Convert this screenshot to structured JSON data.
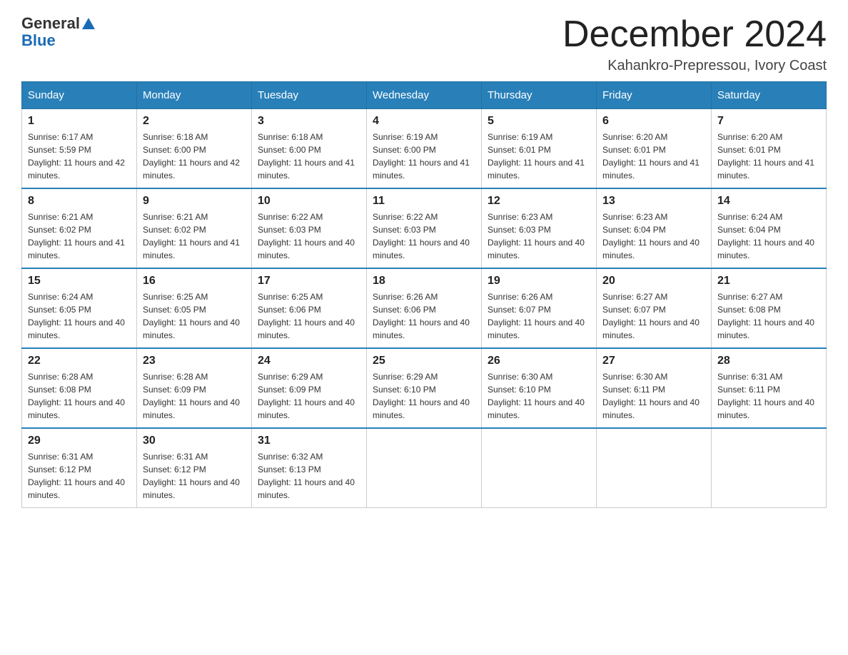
{
  "header": {
    "logo_general": "General",
    "logo_blue": "Blue",
    "month_title": "December 2024",
    "location": "Kahankro-Prepressou, Ivory Coast"
  },
  "calendar": {
    "days_of_week": [
      "Sunday",
      "Monday",
      "Tuesday",
      "Wednesday",
      "Thursday",
      "Friday",
      "Saturday"
    ],
    "weeks": [
      [
        {
          "day": "1",
          "sunrise": "6:17 AM",
          "sunset": "5:59 PM",
          "daylight": "11 hours and 42 minutes."
        },
        {
          "day": "2",
          "sunrise": "6:18 AM",
          "sunset": "6:00 PM",
          "daylight": "11 hours and 42 minutes."
        },
        {
          "day": "3",
          "sunrise": "6:18 AM",
          "sunset": "6:00 PM",
          "daylight": "11 hours and 41 minutes."
        },
        {
          "day": "4",
          "sunrise": "6:19 AM",
          "sunset": "6:00 PM",
          "daylight": "11 hours and 41 minutes."
        },
        {
          "day": "5",
          "sunrise": "6:19 AM",
          "sunset": "6:01 PM",
          "daylight": "11 hours and 41 minutes."
        },
        {
          "day": "6",
          "sunrise": "6:20 AM",
          "sunset": "6:01 PM",
          "daylight": "11 hours and 41 minutes."
        },
        {
          "day": "7",
          "sunrise": "6:20 AM",
          "sunset": "6:01 PM",
          "daylight": "11 hours and 41 minutes."
        }
      ],
      [
        {
          "day": "8",
          "sunrise": "6:21 AM",
          "sunset": "6:02 PM",
          "daylight": "11 hours and 41 minutes."
        },
        {
          "day": "9",
          "sunrise": "6:21 AM",
          "sunset": "6:02 PM",
          "daylight": "11 hours and 41 minutes."
        },
        {
          "day": "10",
          "sunrise": "6:22 AM",
          "sunset": "6:03 PM",
          "daylight": "11 hours and 40 minutes."
        },
        {
          "day": "11",
          "sunrise": "6:22 AM",
          "sunset": "6:03 PM",
          "daylight": "11 hours and 40 minutes."
        },
        {
          "day": "12",
          "sunrise": "6:23 AM",
          "sunset": "6:03 PM",
          "daylight": "11 hours and 40 minutes."
        },
        {
          "day": "13",
          "sunrise": "6:23 AM",
          "sunset": "6:04 PM",
          "daylight": "11 hours and 40 minutes."
        },
        {
          "day": "14",
          "sunrise": "6:24 AM",
          "sunset": "6:04 PM",
          "daylight": "11 hours and 40 minutes."
        }
      ],
      [
        {
          "day": "15",
          "sunrise": "6:24 AM",
          "sunset": "6:05 PM",
          "daylight": "11 hours and 40 minutes."
        },
        {
          "day": "16",
          "sunrise": "6:25 AM",
          "sunset": "6:05 PM",
          "daylight": "11 hours and 40 minutes."
        },
        {
          "day": "17",
          "sunrise": "6:25 AM",
          "sunset": "6:06 PM",
          "daylight": "11 hours and 40 minutes."
        },
        {
          "day": "18",
          "sunrise": "6:26 AM",
          "sunset": "6:06 PM",
          "daylight": "11 hours and 40 minutes."
        },
        {
          "day": "19",
          "sunrise": "6:26 AM",
          "sunset": "6:07 PM",
          "daylight": "11 hours and 40 minutes."
        },
        {
          "day": "20",
          "sunrise": "6:27 AM",
          "sunset": "6:07 PM",
          "daylight": "11 hours and 40 minutes."
        },
        {
          "day": "21",
          "sunrise": "6:27 AM",
          "sunset": "6:08 PM",
          "daylight": "11 hours and 40 minutes."
        }
      ],
      [
        {
          "day": "22",
          "sunrise": "6:28 AM",
          "sunset": "6:08 PM",
          "daylight": "11 hours and 40 minutes."
        },
        {
          "day": "23",
          "sunrise": "6:28 AM",
          "sunset": "6:09 PM",
          "daylight": "11 hours and 40 minutes."
        },
        {
          "day": "24",
          "sunrise": "6:29 AM",
          "sunset": "6:09 PM",
          "daylight": "11 hours and 40 minutes."
        },
        {
          "day": "25",
          "sunrise": "6:29 AM",
          "sunset": "6:10 PM",
          "daylight": "11 hours and 40 minutes."
        },
        {
          "day": "26",
          "sunrise": "6:30 AM",
          "sunset": "6:10 PM",
          "daylight": "11 hours and 40 minutes."
        },
        {
          "day": "27",
          "sunrise": "6:30 AM",
          "sunset": "6:11 PM",
          "daylight": "11 hours and 40 minutes."
        },
        {
          "day": "28",
          "sunrise": "6:31 AM",
          "sunset": "6:11 PM",
          "daylight": "11 hours and 40 minutes."
        }
      ],
      [
        {
          "day": "29",
          "sunrise": "6:31 AM",
          "sunset": "6:12 PM",
          "daylight": "11 hours and 40 minutes."
        },
        {
          "day": "30",
          "sunrise": "6:31 AM",
          "sunset": "6:12 PM",
          "daylight": "11 hours and 40 minutes."
        },
        {
          "day": "31",
          "sunrise": "6:32 AM",
          "sunset": "6:13 PM",
          "daylight": "11 hours and 40 minutes."
        },
        null,
        null,
        null,
        null
      ]
    ]
  }
}
